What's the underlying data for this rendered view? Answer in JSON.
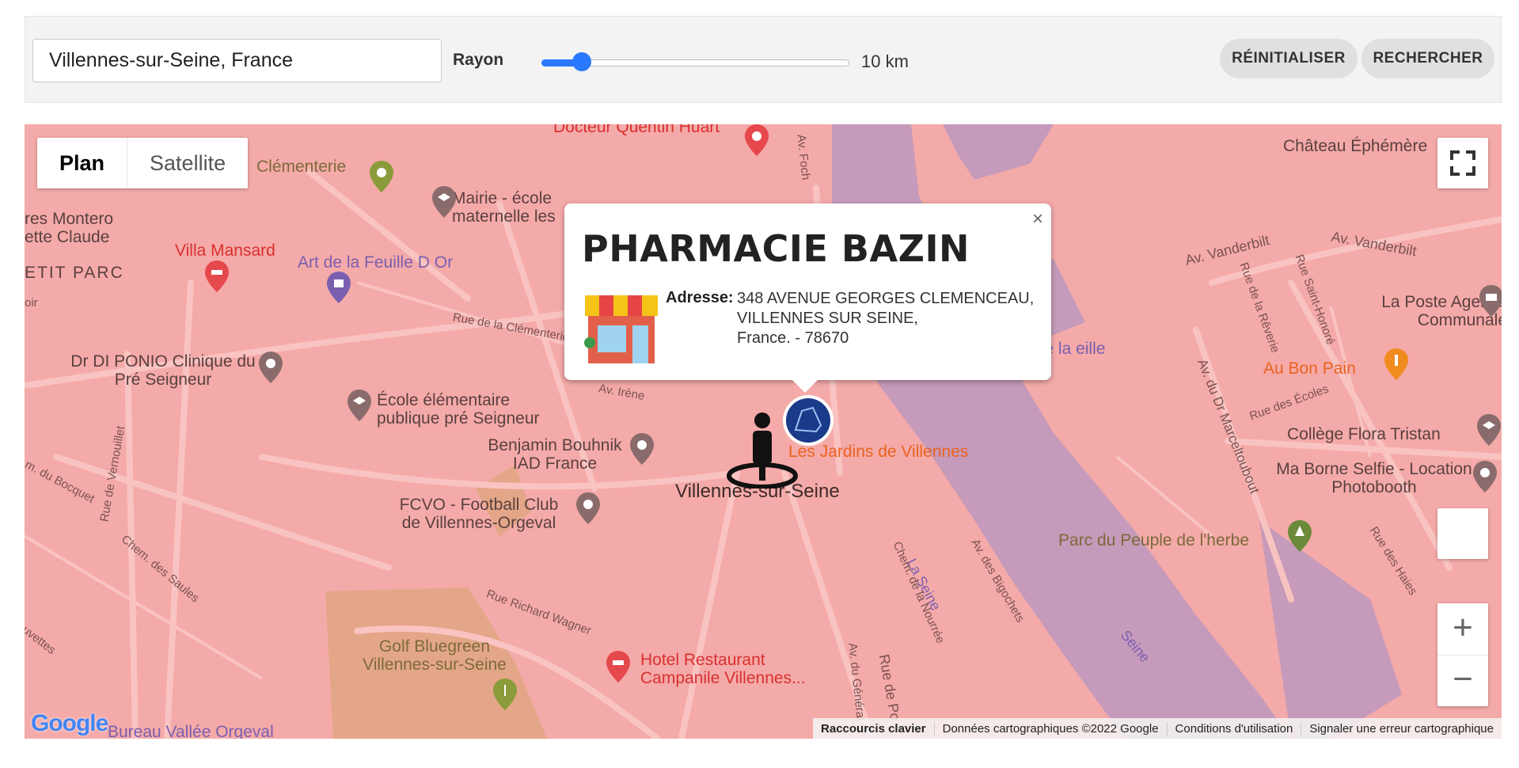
{
  "search": {
    "location_value": "Villennes-sur-Seine, France",
    "radius_label": "Rayon",
    "radius_value": "10 km",
    "radius_level": 0.13,
    "reset_label": "RÉINITIALISER",
    "search_label": "RECHERCHER"
  },
  "map": {
    "type_plan": "Plan",
    "type_satellite": "Satellite",
    "zoom_in": "+",
    "zoom_out": "−",
    "labels": {
      "docteur": "Docteur Quentin Huart",
      "chateau": "Château Éphémère",
      "clementerie": "Clémenterie",
      "mairie": "Mairie - école maternelle les",
      "montero": "res Montero ette Claude",
      "villa": "Villa Mansard",
      "art": "Art de la Feuille D Or",
      "petit_parc": "ETIT PARC",
      "vanderbilt1": "Av. Vanderbilt",
      "vanderbilt2": "Av. Vanderbilt",
      "poste": "La Poste Agence Communale",
      "etang": "tang de la eille ferme",
      "bon_pain": "Au Bon Pain",
      "ponio": "Dr DI PONIO Clinique du Pré Seigneur",
      "ecole": "École élémentaire publique pré Seigneur",
      "college": "Collège Flora Tristan",
      "benjamin": "Benjamin Bouhnik IAD France",
      "jardins": "Les Jardins de Villennes",
      "selfie": "Ma Borne Selfie - Location Photobooth",
      "villennes": "Villennes-sur-Seine",
      "fcvo": "FCVO - Football Club de Villennes-Orgeval",
      "parc": "Parc du Peuple de l'herbe",
      "golf": "Golf Bluegreen Villennes-sur-Seine",
      "hotel": "Hotel Restaurant Campanile Villennes...",
      "bureau": "Bureau Vallée Orgeval",
      "la_seine": "La Seine",
      "seine": "Seine",
      "rue_clementerie": "Rue de la Clémenterie",
      "rue_vernouillet": "Rue de Vernouillet",
      "chem_saules": "Chem. des Saules",
      "bocquet": "m. du Bocquet",
      "rue_wagner": "Rue Richard Wagner",
      "marcel": "Av. du Dr Marceltoubout",
      "reverie": "Rue de la Rêverie",
      "saint_honore": "Rue Saint-Honoré",
      "ecoles": "Rue des Écoles",
      "haies": "Rue des Haies",
      "bigochets": "Av. des Bigochets",
      "nourree": "Chem. de la Nourrée",
      "av_irene": "Av. Irène",
      "foch": "Av. Foch",
      "general": "Av. du Général C",
      "rue_po": "Rue de Po",
      "ovettes": "uvettes",
      "oir": "oir"
    },
    "attribution": {
      "shortcuts": "Raccourcis clavier",
      "data": "Données cartographiques ©2022 Google",
      "terms": "Conditions d'utilisation",
      "report": "Signaler une erreur cartographique"
    },
    "logo": "Google"
  },
  "infowindow": {
    "title": "PHARMACIE BAZIN",
    "address_label": "Adresse:",
    "address_line1": "348 AVENUE GEORGES CLEMENCEAU,",
    "address_line2": "VILLENNES SUR SEINE,",
    "address_line3": "France. - 78670",
    "close": "×"
  },
  "colors": {
    "accent": "#2979ff",
    "map_overlay": "#f4aaa8",
    "water": "#c59aba",
    "pin_red": "#e5484d",
    "pin_gray": "#8a6b6b",
    "marker_blue": "#1a3a8a"
  }
}
